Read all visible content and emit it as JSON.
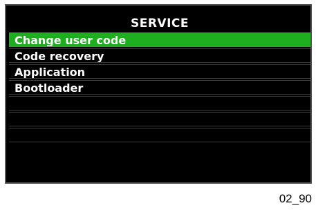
{
  "screen": {
    "title": "SERVICE",
    "menu_items": [
      {
        "label": "Change user code",
        "selected": true
      },
      {
        "label": "Code recovery",
        "selected": false
      },
      {
        "label": "Application",
        "selected": false
      },
      {
        "label": "Bootloader",
        "selected": false
      },
      {
        "label": "",
        "selected": false
      },
      {
        "label": "",
        "selected": false
      },
      {
        "label": "",
        "selected": false
      }
    ]
  },
  "figure_ref": "02_90",
  "colors": {
    "background": "#000000",
    "highlight": "#1fae1f",
    "text": "#ffffff"
  }
}
